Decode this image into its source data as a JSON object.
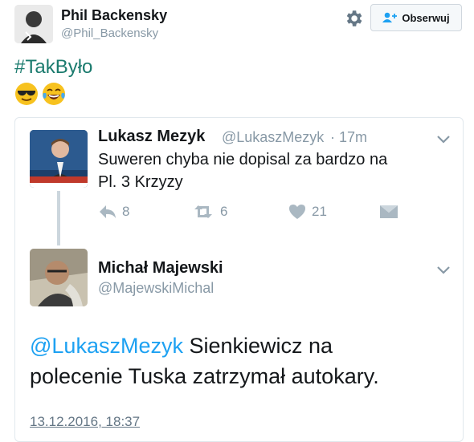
{
  "header": {
    "display_name": "Phil Backensky",
    "handle": "@Phil_Backensky",
    "follow_label": "Obserwuj"
  },
  "tweet": {
    "hashtag": "#TakByło",
    "emojis": [
      "sunglasses-face",
      "laughing-tears-face"
    ]
  },
  "quoted_thread": {
    "parent": {
      "display_name": "Lukasz Mezyk",
      "handle": "@LukaszMezyk",
      "time": "· 17m",
      "text_line1": "Suweren chyba nie dopisal za bardzo na",
      "text_line2": "Pl. 3 Krzyzy",
      "stats": {
        "replies": "8",
        "retweets": "6",
        "likes": "21"
      }
    },
    "reply": {
      "display_name": "Michał Majewski",
      "handle": "@MajewskiMichal",
      "mention": "@LukaszMezyk",
      "text_line1_rest": " Sienkiewicz na",
      "text_line2": "polecenie Tuska zatrzymał autokary.",
      "date": "13.12.2016, 18:37"
    }
  },
  "colors": {
    "accent_link": "#1da1f2",
    "hashtag": "#1b7b6e",
    "muted": "#8899a6"
  }
}
